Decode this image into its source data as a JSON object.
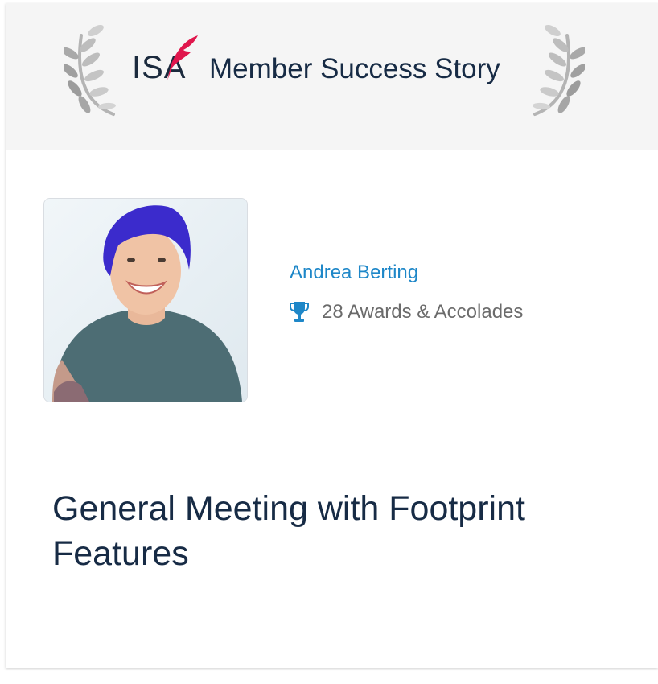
{
  "banner": {
    "logo_text": "ISA",
    "title": "Member Success Story",
    "left_decoration_icon": "laurel-wreath-left-icon",
    "right_decoration_icon": "laurel-wreath-right-icon"
  },
  "member": {
    "name": "Andrea Berting",
    "avatar_icon": "member-photo",
    "awards_icon": "trophy-icon",
    "awards_text": "28 Awards & Accolades"
  },
  "story": {
    "title": "General Meeting with Footprint Features"
  },
  "colors": {
    "banner_bg": "#f5f5f5",
    "title_text": "#172b45",
    "link_blue": "#1e87c8",
    "logo_quill": "#e0174d",
    "muted_text": "#6b6b6b"
  }
}
